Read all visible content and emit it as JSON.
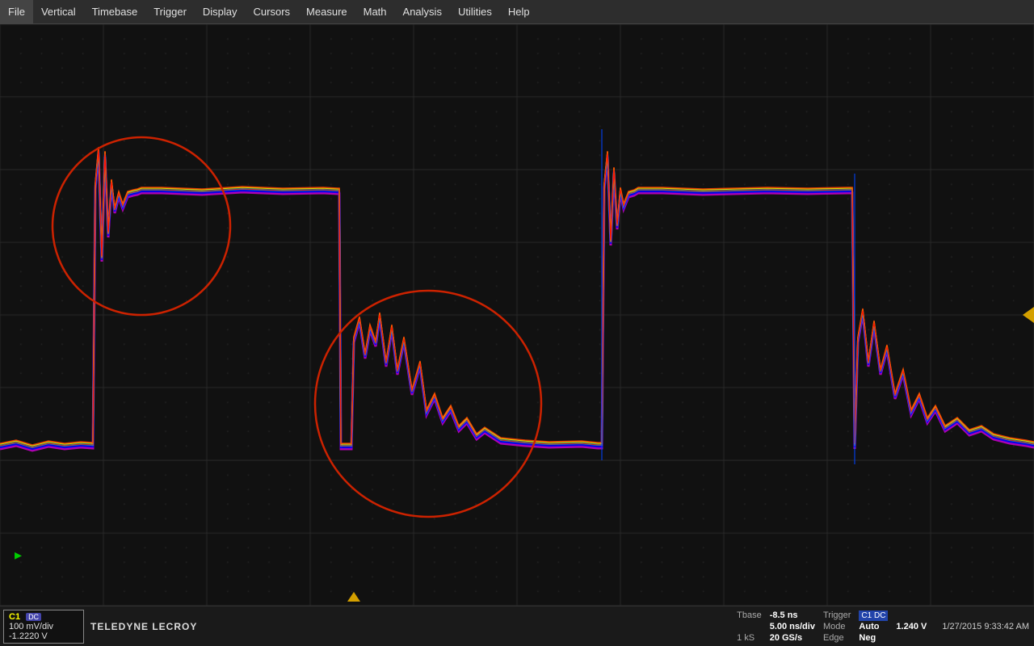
{
  "menubar": {
    "items": [
      "File",
      "Vertical",
      "Timebase",
      "Trigger",
      "Display",
      "Cursors",
      "Measure",
      "Math",
      "Analysis",
      "Utilities",
      "Help"
    ]
  },
  "scope": {
    "grid": {
      "cols": 10,
      "rows": 8,
      "bg_color": "#111111",
      "grid_color": "#2a2a2a",
      "dot_color": "#333333"
    }
  },
  "channel": {
    "name": "C1",
    "dc_label": "DC",
    "volts_per_div": "100 mV/div",
    "offset": "-1.2220 V"
  },
  "timebase": {
    "label": "Tbase",
    "offset": "-8.5 ns",
    "per_div": "5.00 ns/div",
    "samples": "1 kS",
    "sample_rate": "20 GS/s"
  },
  "trigger": {
    "label": "Trigger",
    "channel_badge": "C1 DC",
    "mode": "Auto",
    "level": "1.240 V",
    "type": "Edge",
    "slope": "Neg"
  },
  "brand": "TELEDYNE LECROY",
  "datetime": "1/27/2015  9:33:42 AM",
  "annotations": {
    "circle1": {
      "label": "annotation-circle-1"
    },
    "circle2": {
      "label": "annotation-circle-2"
    }
  }
}
